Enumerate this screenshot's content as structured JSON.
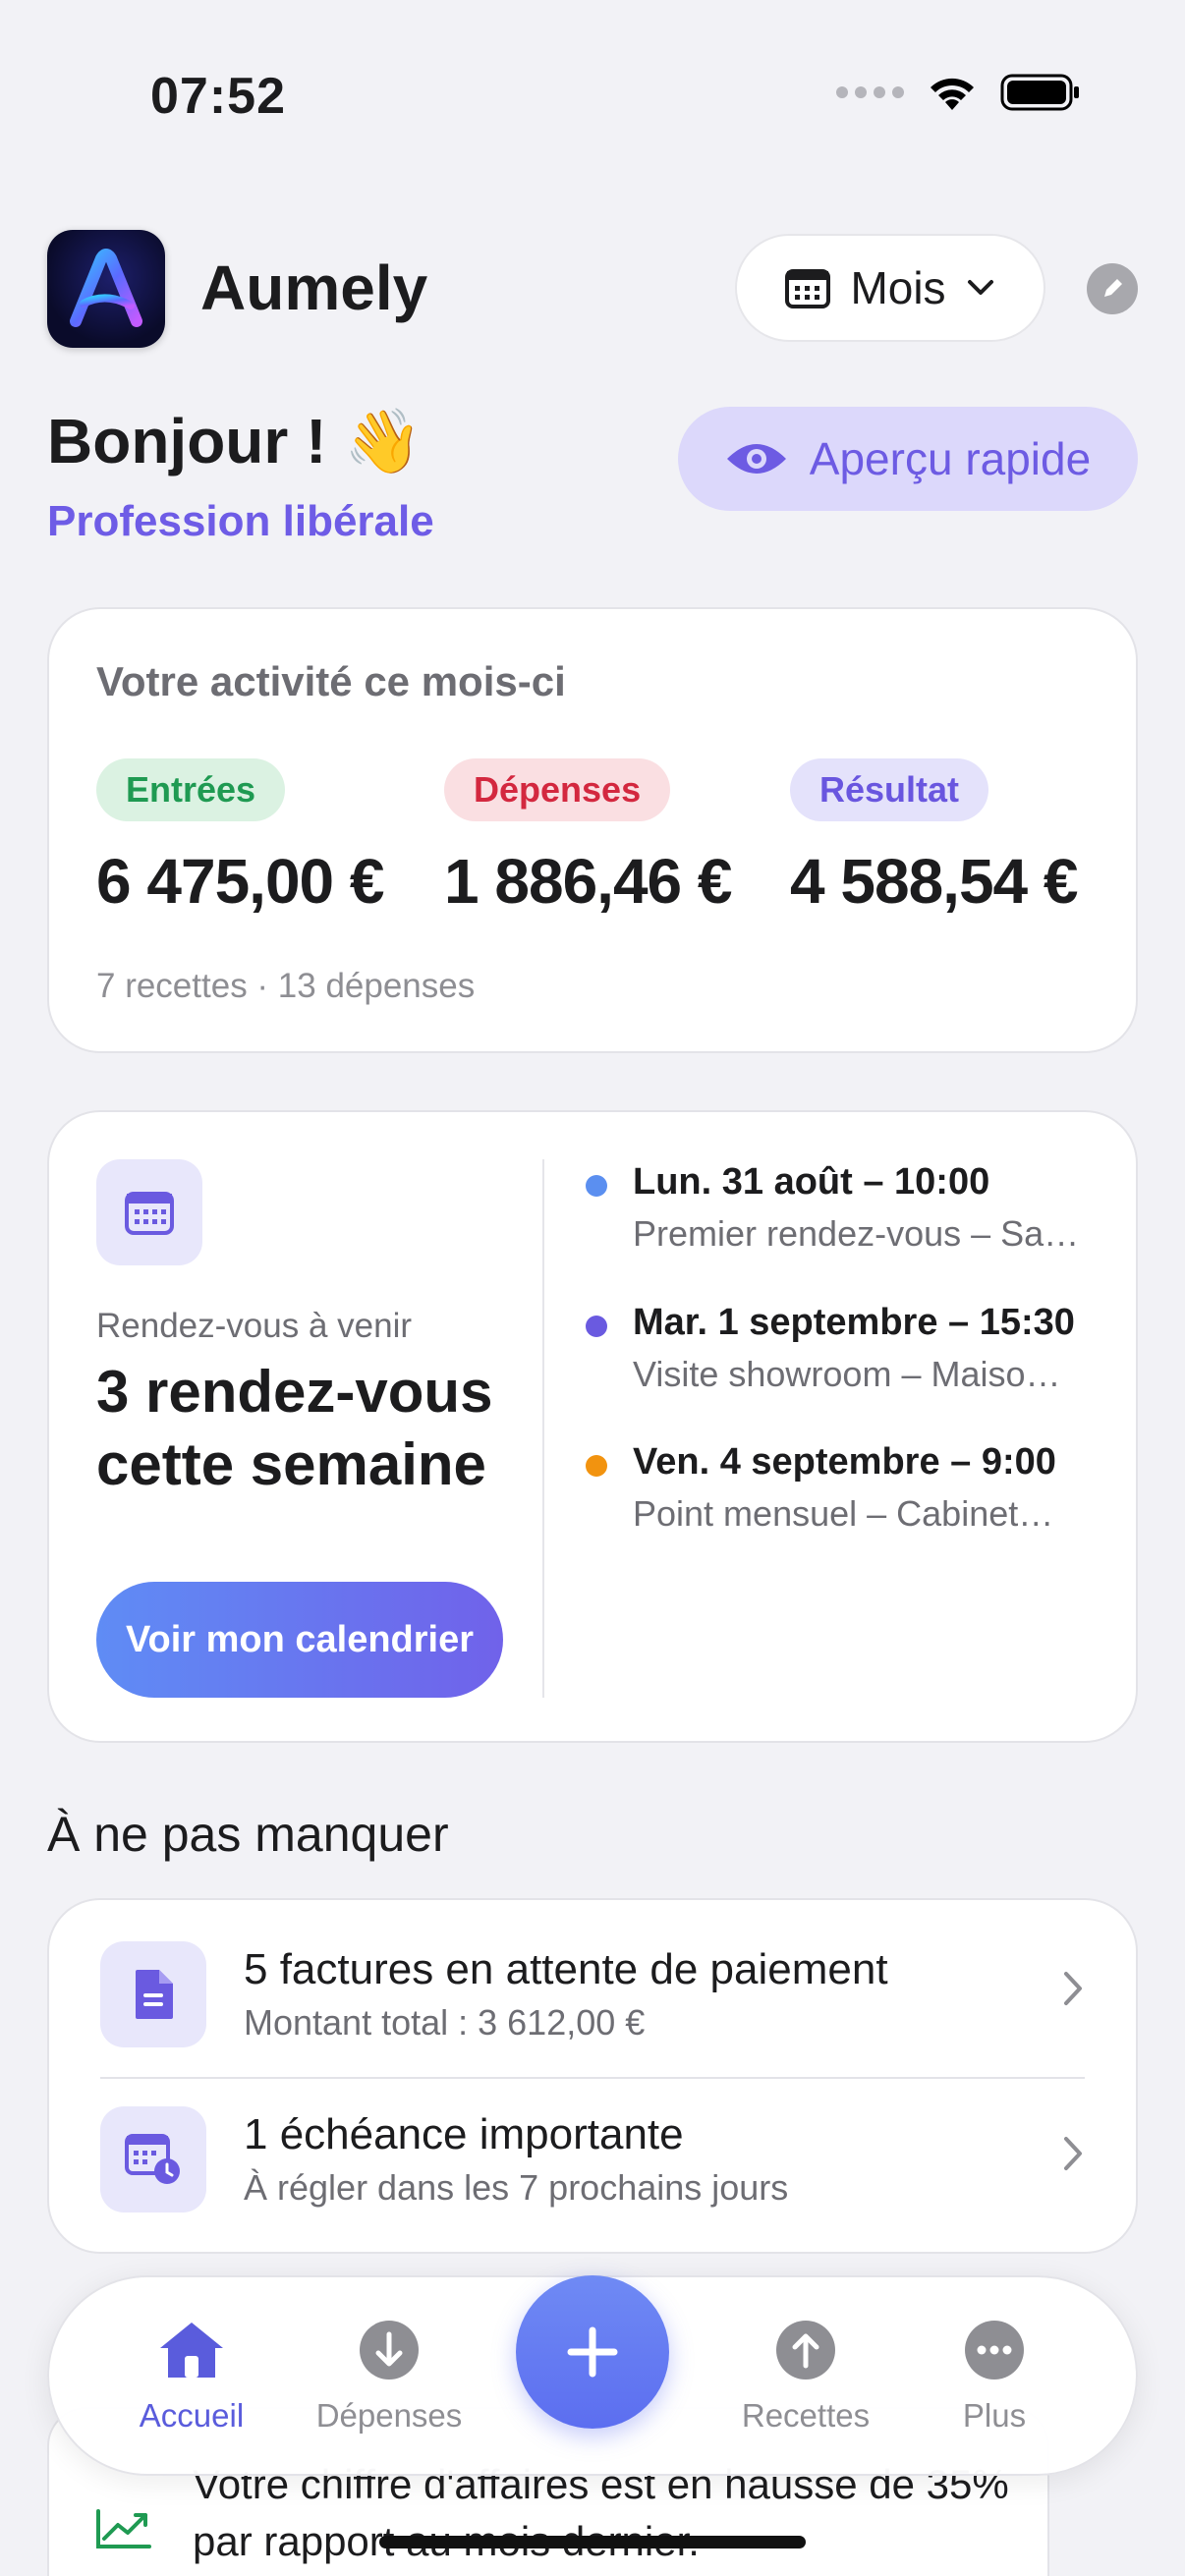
{
  "status_bar": {
    "time": "07:52"
  },
  "header": {
    "app_name": "Aumely",
    "period": "Mois"
  },
  "greeting": {
    "title": "Bonjour ! 👋",
    "profession": "Profession libérale"
  },
  "quick_view": {
    "label": "Aperçu rapide"
  },
  "activity": {
    "title": "Votre activité ce mois-ci",
    "metrics": [
      {
        "label": "Entrées",
        "amount": "6 475,00 €",
        "color": "#1f9a52"
      },
      {
        "label": "Dépenses",
        "amount": "1 886,46 €",
        "color": "#d3283f"
      },
      {
        "label": "Résultat",
        "amount": "4 588,54 €",
        "color": "#6956df"
      }
    ],
    "counts": "7 recettes · 13 dépenses"
  },
  "appointments": {
    "label": "Rendez-vous à venir",
    "title": "3 rendez-vous cette semaine",
    "button": "Voir mon calendrier",
    "events": [
      {
        "date": "Lun. 31 août – 10:00",
        "description": "Premier rendez-vous – Sa…",
        "color": "#5b8ff0"
      },
      {
        "date": "Mar. 1 septembre – 15:30",
        "description": "Visite showroom – Maiso…",
        "color": "#6a5ae0"
      },
      {
        "date": "Ven. 4 septembre – 9:00",
        "description": "Point mensuel – Cabinet…",
        "color": "#f2930f"
      }
    ]
  },
  "alerts": {
    "section_title": "À ne pas manquer",
    "items": [
      {
        "title": "5 factures en attente de paiement",
        "subtitle": "Montant total : 3 612,00 €",
        "icon": "invoice-icon"
      },
      {
        "title": "1 échéance importante",
        "subtitle": "À régler dans les 7 prochains jours",
        "icon": "calendar-clock-icon"
      }
    ]
  },
  "insight": {
    "text": "Votre chiffre d'affaires est en hausse de 35% par rapport au mois dernier.",
    "icon": "trend-up-icon"
  },
  "tab_bar": {
    "tabs": [
      {
        "label": "Accueil",
        "icon": "home-icon",
        "active": true
      },
      {
        "label": "Dépenses",
        "icon": "arrow-down-circle-icon",
        "active": false
      },
      {
        "label": "Recettes",
        "icon": "arrow-up-circle-icon",
        "active": false
      },
      {
        "label": "Plus",
        "icon": "more-icon",
        "active": false
      }
    ],
    "add_label": "+"
  },
  "colors": {
    "accent": "#6e5ce6",
    "green": "#1f9a52",
    "red": "#d3283f",
    "background": "#f2f2f6"
  }
}
